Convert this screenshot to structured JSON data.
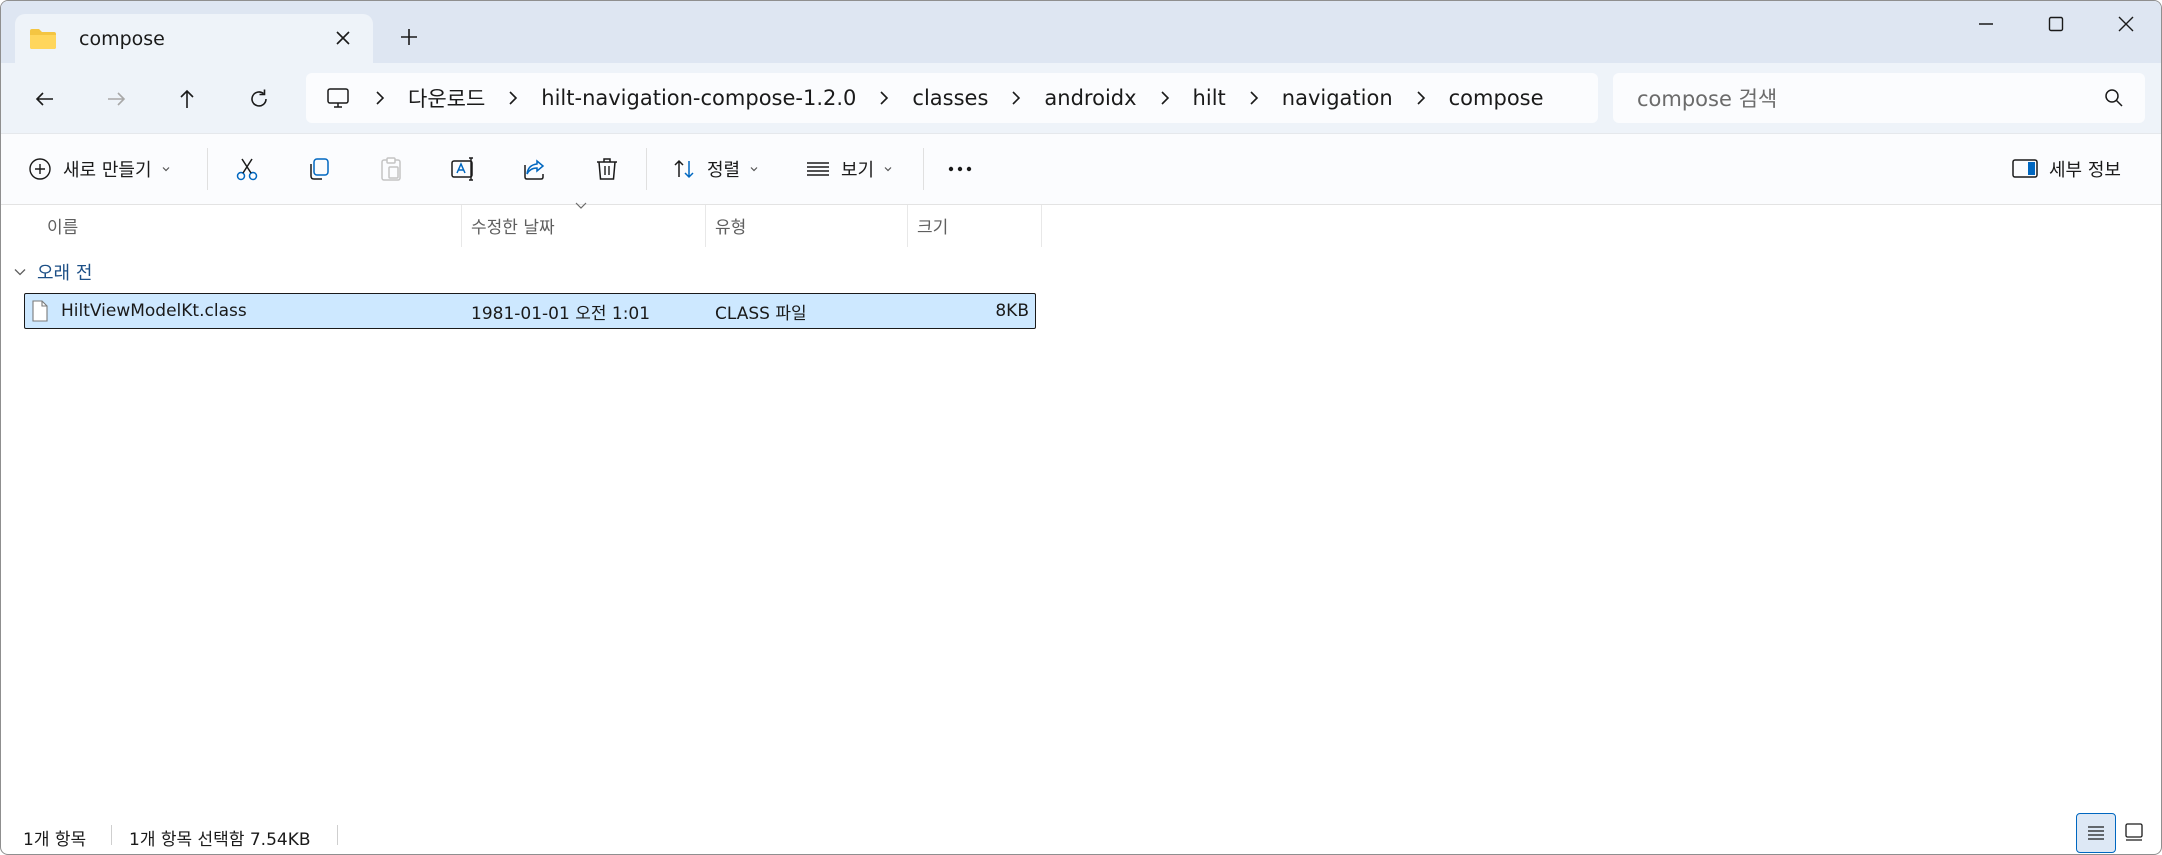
{
  "tab": {
    "title": "compose"
  },
  "nav": {
    "breadcrumbs": [
      "다운로드",
      "hilt-navigation-compose-1.2.0",
      "classes",
      "androidx",
      "hilt",
      "navigation",
      "compose"
    ],
    "search_placeholder": "compose 검색"
  },
  "toolbar": {
    "new_label": "새로 만들기",
    "sort_label": "정렬",
    "view_label": "보기",
    "details_label": "세부 정보"
  },
  "columns": {
    "name": "이름",
    "date": "수정한 날짜",
    "type": "유형",
    "size": "크기"
  },
  "group": {
    "label": "오래 전"
  },
  "file": {
    "name": "HiltViewModelKt.class",
    "date": "1981-01-01 오전 1:01",
    "type": "CLASS 파일",
    "size": "8KB"
  },
  "status": {
    "count": "1개 항목",
    "selected": "1개 항목 선택함 7.54KB"
  },
  "colors": {
    "accent": "#0067c0",
    "selection": "#cde8ff",
    "titlebar": "#dee6f2"
  }
}
